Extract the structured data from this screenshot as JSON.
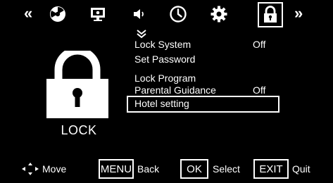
{
  "top_bar": {
    "prev_glyph": "«",
    "next_glyph": "»",
    "tabs": [
      {
        "icon": "picture-icon"
      },
      {
        "icon": "channel-icon"
      },
      {
        "icon": "sound-icon"
      },
      {
        "icon": "clock-icon"
      },
      {
        "icon": "gear-icon"
      },
      {
        "icon": "lock-icon",
        "selected": true
      }
    ]
  },
  "section": {
    "label": "LOCK",
    "icon": "padlock-icon"
  },
  "menu": {
    "scroll_up_icon": "chevron-up-icon",
    "items": [
      {
        "label": "Lock System",
        "value": "Off"
      },
      {
        "label": "Set Password",
        "value": ""
      },
      {
        "label": "Lock Program",
        "value": ""
      },
      {
        "label": "Parental Guidance",
        "value": "Off"
      },
      {
        "label": "Hotel setting",
        "value": "",
        "focused": true
      }
    ]
  },
  "footer": {
    "move_label": "Move",
    "menu_key": "MENU",
    "back_label": "Back",
    "ok_key": "OK",
    "select_label": "Select",
    "exit_key": "EXIT",
    "quit_label": "Quit"
  },
  "colors": {
    "background": "#000000",
    "foreground": "#ffffff"
  }
}
